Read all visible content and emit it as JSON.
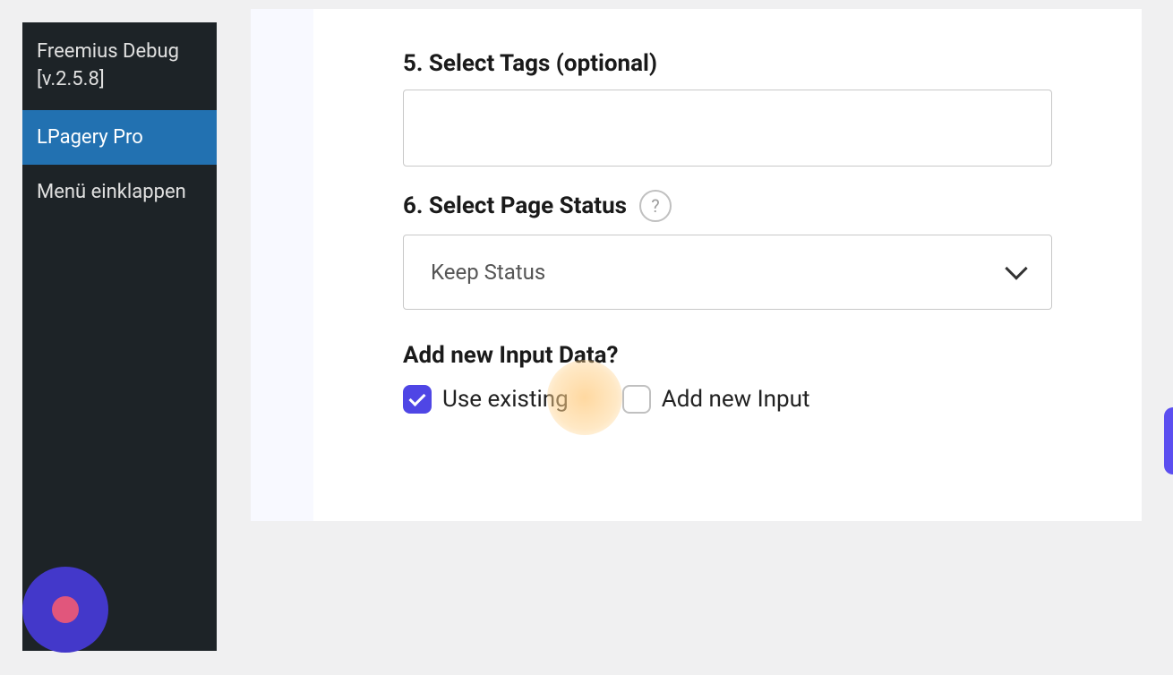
{
  "sidebar": {
    "items": [
      {
        "label": "Freemius Debug [v.2.5.8]",
        "active": false,
        "multiline": true
      },
      {
        "label": "LPagery Pro",
        "active": true,
        "multiline": false
      },
      {
        "label": "Menü einklappen",
        "active": false,
        "multiline": false
      }
    ]
  },
  "form": {
    "section5": {
      "heading": "5. Select Tags (optional)"
    },
    "section6": {
      "heading": "6. Select Page Status",
      "help_tooltip": "?",
      "selected_value": "Keep Status"
    },
    "input_data": {
      "heading": "Add new Input Data?",
      "option1": {
        "label": "Use existing",
        "checked": true
      },
      "option2": {
        "label": "Add new Input",
        "checked": false
      }
    }
  }
}
